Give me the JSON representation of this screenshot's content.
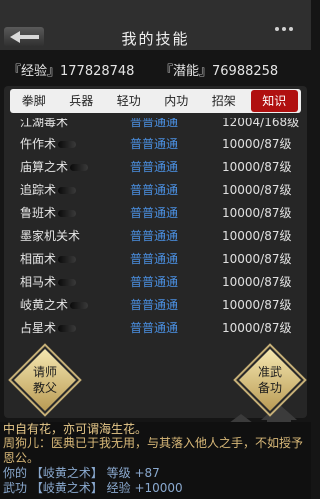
{
  "header": {
    "title": "我的技能"
  },
  "stats": {
    "experience": "『经验』177828748",
    "potential": "『潜能』76988258"
  },
  "tabs": [
    "拳脚",
    "兵器",
    "轻功",
    "内功",
    "招架",
    "知识"
  ],
  "active_tab": "知识",
  "skills": [
    {
      "name": "江湖毒术",
      "level": "普普通通",
      "value": "12004/168级"
    },
    {
      "name": "仵作术",
      "level": "普普通通",
      "value": "10000/87级"
    },
    {
      "name": "庙算之术",
      "level": "普普通通",
      "value": "10000/87级"
    },
    {
      "name": "追踪术",
      "level": "普普通通",
      "value": "10000/87级"
    },
    {
      "name": "鲁班术",
      "level": "普普通通",
      "value": "10000/87级"
    },
    {
      "name": "墨家机关术",
      "level": "普普通通",
      "value": "10000/87级"
    },
    {
      "name": "相面术",
      "level": "普普通通",
      "value": "10000/87级"
    },
    {
      "name": "相马术",
      "level": "普普通通",
      "value": "10000/87级"
    },
    {
      "name": "岐黄之术",
      "level": "普普通通",
      "value": "10000/87级"
    },
    {
      "name": "占星术",
      "level": "普普通通",
      "value": "10000/87级"
    }
  ],
  "buttons": {
    "teach": "请师\n教父",
    "prepare": "准武\n备功"
  },
  "log": {
    "line1": "中自有花，亦可谓海生花。",
    "line2": "周狗儿：医典已于我无用，与其落入他人之手，不如授予恩公。",
    "line3": "你的 【岐黄之术】 等级 +87",
    "line4": "武功 【岐黄之术】 经验 +10000"
  }
}
